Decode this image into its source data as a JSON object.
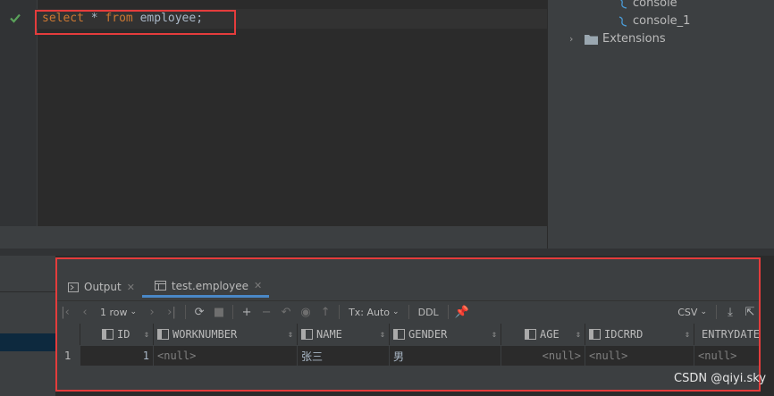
{
  "editor": {
    "sql": {
      "kw1": "select",
      "star": " * ",
      "kw2": "from",
      "table": " employee;"
    }
  },
  "tree": {
    "items": [
      {
        "label": "console"
      },
      {
        "label": "console_1"
      },
      {
        "label": "Extensions"
      }
    ]
  },
  "results": {
    "tabs": [
      {
        "label": "Output"
      },
      {
        "label": "test.employee"
      }
    ],
    "toolbar": {
      "rows_label": "1 row",
      "tx_label": "Tx: Auto",
      "ddl_label": "DDL",
      "export_label": "CSV"
    },
    "columns": [
      "ID",
      "WORKNUMBER",
      "NAME",
      "GENDER",
      "AGE",
      "IDCRRD",
      "ENTRYDATE"
    ],
    "rows": [
      {
        "num": "1",
        "id": "1",
        "worknumber": "<null>",
        "name": "张三",
        "gender": "男",
        "age": "<null>",
        "idcrrd": "<null>",
        "entrydate": "<null>"
      }
    ]
  },
  "watermark": "CSDN @qiyi.sky"
}
